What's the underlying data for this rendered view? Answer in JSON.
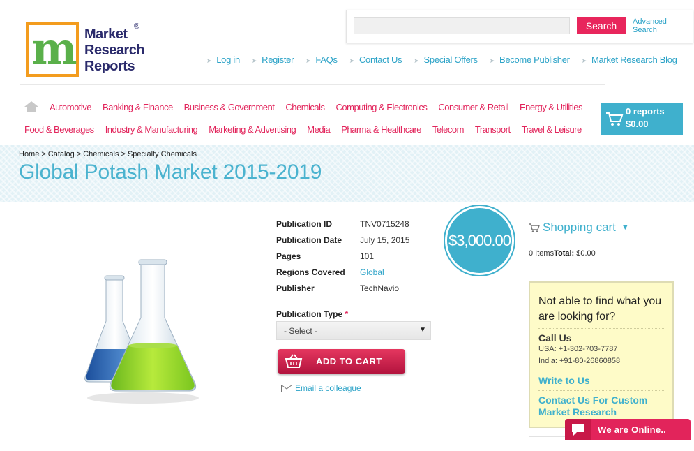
{
  "logo": {
    "letter": "m",
    "text_line1": "Market",
    "text_line2": "Research",
    "text_line3": "Reports",
    "reg_mark": "®"
  },
  "search": {
    "placeholder": "",
    "button_label": "Search",
    "advanced_line1": "Advanced",
    "advanced_line2": "Search"
  },
  "top_links": [
    "Log in",
    "Register",
    "FAQs",
    "Contact Us",
    "Special Offers",
    "Become Publisher",
    "Market Research Blog"
  ],
  "categories_row1": [
    "Automotive",
    "Banking & Finance",
    "Business & Government",
    "Chemicals",
    "Computing & Electronics",
    "Consumer & Retail",
    "Energy & Utilities"
  ],
  "categories_row2": [
    "Food & Beverages",
    "Industry & Manufacturing",
    "Marketing & Advertising",
    "Media",
    "Pharma & Healthcare",
    "Telecom",
    "Transport",
    "Travel & Leisure"
  ],
  "cart_button": {
    "reports": "0 reports",
    "amount": "$0.00"
  },
  "breadcrumb": [
    "Home",
    "Catalog",
    "Chemicals",
    "Specialty Chemicals"
  ],
  "breadcrumb_sep": ">",
  "page_title": "Global Potash Market 2015-2019",
  "details": [
    {
      "label": "Publication ID",
      "value": "TNV0715248"
    },
    {
      "label": "Publication Date",
      "value": "July 15, 2015"
    },
    {
      "label": "Pages",
      "value": "101"
    },
    {
      "label": "Regions Covered",
      "value": "Global"
    },
    {
      "label": "Publisher",
      "value": "TechNavio"
    }
  ],
  "price": "$3,000.00",
  "publication_type": {
    "label": "Publication Type",
    "required_mark": "*",
    "selected": "- Select -"
  },
  "add_to_cart_label": "ADD TO CART",
  "email_colleague": "Email a colleague",
  "shopping_cart": {
    "title": "Shopping cart",
    "items": "0 Items",
    "total_label": "Total:",
    "total_value": "$0.00"
  },
  "help": {
    "question": "Not able to find what you are looking for?",
    "call_us": "Call Us",
    "usa": "USA: +1-302-703-7787",
    "india": "India: +91-80-26860858",
    "write_to_us": "Write to Us",
    "custom_research": "Contact Us For Custom Market Research"
  },
  "online_label": "We are Online..",
  "colors": {
    "accent_pink": "#e2245b",
    "accent_blue": "#3fb0cd",
    "link_blue": "#2aa2c7"
  }
}
